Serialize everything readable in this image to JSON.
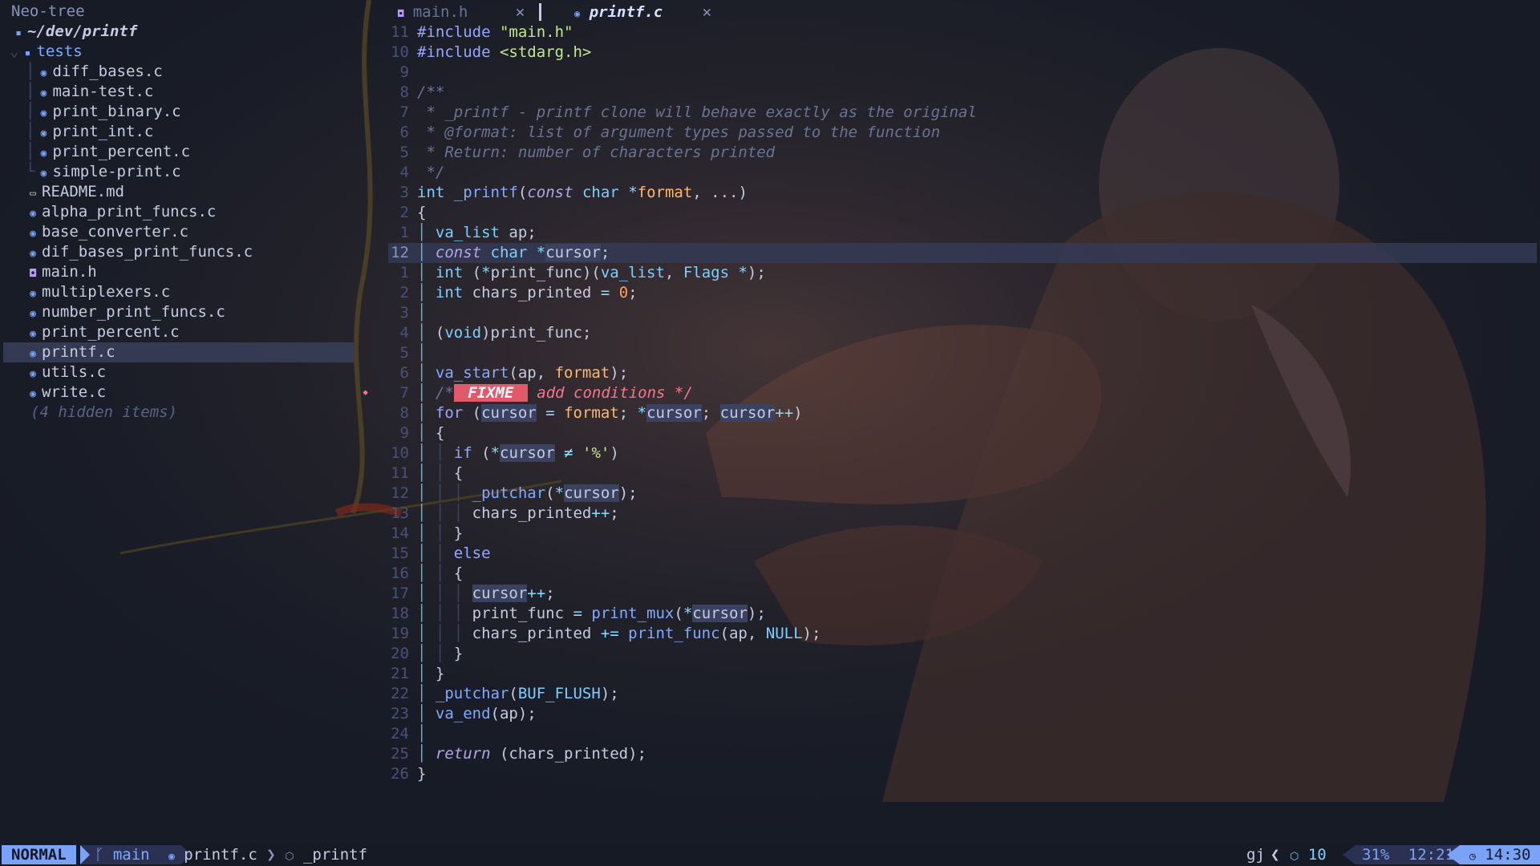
{
  "sidebar": {
    "title": "Neo-tree",
    "root": "~/dev/printf",
    "folder": "tests",
    "test_files": [
      "diff_bases.c",
      "main-test.c",
      "print_binary.c",
      "print_int.c",
      "print_percent.c",
      "simple-print.c"
    ],
    "files": [
      {
        "name": "README.md",
        "icon": "markdown-icon"
      },
      {
        "name": "alpha_print_funcs.c",
        "icon": "c-file-icon"
      },
      {
        "name": "base_converter.c",
        "icon": "c-file-icon"
      },
      {
        "name": "dif_bases_print_funcs.c",
        "icon": "c-file-icon"
      },
      {
        "name": "main.h",
        "icon": "header-file-icon"
      },
      {
        "name": "multiplexers.c",
        "icon": "c-file-icon"
      },
      {
        "name": "number_print_funcs.c",
        "icon": "c-file-icon"
      },
      {
        "name": "print_percent.c",
        "icon": "c-file-icon"
      },
      {
        "name": "printf.c",
        "icon": "c-file-icon",
        "selected": true
      },
      {
        "name": "utils.c",
        "icon": "c-file-icon"
      },
      {
        "name": "write.c",
        "icon": "c-file-icon"
      }
    ],
    "hidden": "(4 hidden items)"
  },
  "tabs": [
    {
      "label": "main.h",
      "close": "✕",
      "active": false
    },
    {
      "label": "printf.c",
      "close": "✕",
      "active": true
    }
  ],
  "editor": {
    "current_line": "12",
    "line_numbers": [
      "11",
      "10",
      "9",
      "8",
      "7",
      "6",
      "5",
      "4",
      "3",
      "2",
      "1",
      "12",
      "1",
      "2",
      "3",
      "4",
      "5",
      "6",
      "7",
      "8",
      "9",
      "10",
      "11",
      "12",
      "13",
      "14",
      "15",
      "16",
      "17",
      "18",
      "19",
      "20",
      "21",
      "22",
      "23",
      "24",
      "25",
      "26"
    ]
  },
  "statusbar": {
    "mode": "NORMAL",
    "branch": "main",
    "file": "printf.c",
    "symbol": "_printf",
    "keys": "gj",
    "diagnostics": "10",
    "percent": "31%",
    "position": "12:21",
    "clock": "14:30"
  },
  "colors": {
    "background": "#171b26",
    "accent": "#7aa2f7",
    "fixme": "#e05a6a"
  }
}
